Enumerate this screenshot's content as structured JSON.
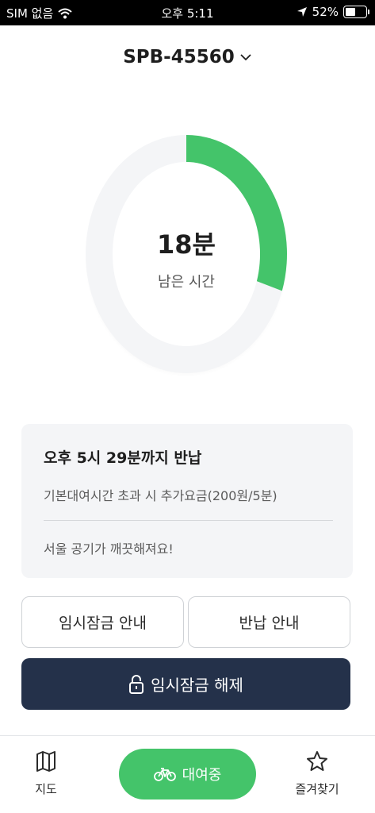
{
  "status_bar": {
    "carrier": "SIM 없음",
    "time": "오후 5:11",
    "battery_percent": "52%",
    "battery_level": 0.52,
    "icons": [
      "wifi-icon",
      "location-arrow-icon",
      "battery-icon"
    ]
  },
  "header": {
    "bike_id": "SPB-45560",
    "dropdown_icon": "chevron-down-icon"
  },
  "timer": {
    "minutes_value": "18분",
    "label": "남은 시간",
    "remaining_fraction": 0.3,
    "progress_color": "#44c46a",
    "track_color": "#f4f5f7"
  },
  "info_card": {
    "return_time": "오후 5시 29분까지 반납",
    "fee_notice": "기본대여시간 초과 시 추가요금(200원/5분)",
    "message": "서울 공기가 깨끗해져요!"
  },
  "buttons": {
    "temp_lock_guide": "임시잠금 안내",
    "return_guide": "반납 안내",
    "unlock_temp": "임시잠금 해제",
    "unlock_icon": "padlock-icon"
  },
  "bottom_nav": {
    "map_label": "지도",
    "map_icon": "map-icon",
    "rent_label": "대여중",
    "rent_icon": "bicycle-icon",
    "fav_label": "즐겨찾기",
    "fav_icon": "star-icon",
    "accent_color": "#44c46a"
  },
  "colors": {
    "primary_dark": "#24314a",
    "card_bg": "#f4f5f7"
  }
}
